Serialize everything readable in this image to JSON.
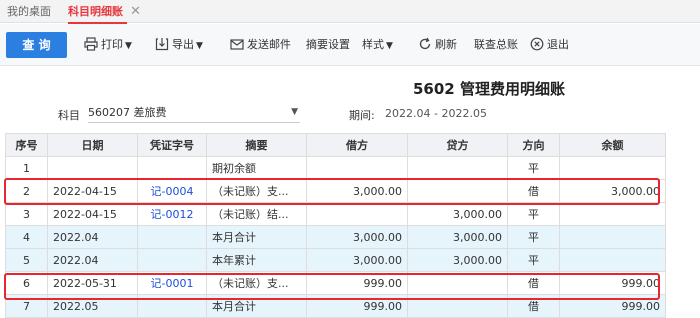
{
  "tabs": {
    "home": "我的桌面",
    "active": "科目明细账",
    "close": "✕"
  },
  "toolbar": {
    "query": "查 询",
    "print": "打印",
    "export": "导出",
    "send_email": "发送邮件",
    "summary_settings": "摘要设置",
    "style": "样式",
    "refresh": "刷新",
    "linked_ledger": "联查总账",
    "exit": "退出"
  },
  "report": {
    "title": "5602 管理费用明细账",
    "subject_label": "科目",
    "subject_value": "560207 差旅费",
    "period_label": "期间:",
    "period_value": "2022.04 - 2022.05"
  },
  "table": {
    "headers": [
      "序号",
      "日期",
      "凭证字号",
      "摘要",
      "借方",
      "贷方",
      "方向",
      "余额"
    ],
    "rows": [
      {
        "no": "1",
        "date": "",
        "voucher": "",
        "summary": "期初余额",
        "debit": "",
        "credit": "",
        "direction": "平",
        "balance": ""
      },
      {
        "no": "2",
        "date": "2022-04-15",
        "voucher": "记-0004",
        "summary": "（未记账）支...",
        "debit": "3,000.00",
        "credit": "",
        "direction": "借",
        "balance": "3,000.00"
      },
      {
        "no": "3",
        "date": "2022-04-15",
        "voucher": "记-0012",
        "summary": "（未记账）结...",
        "debit": "",
        "credit": "3,000.00",
        "direction": "平",
        "balance": ""
      },
      {
        "no": "4",
        "date": "2022.04",
        "voucher": "",
        "summary": "本月合计",
        "debit": "3,000.00",
        "credit": "3,000.00",
        "direction": "平",
        "balance": ""
      },
      {
        "no": "5",
        "date": "2022.04",
        "voucher": "",
        "summary": "本年累计",
        "debit": "3,000.00",
        "credit": "3,000.00",
        "direction": "平",
        "balance": ""
      },
      {
        "no": "6",
        "date": "2022-05-31",
        "voucher": "记-0001",
        "summary": "（未记账）支...",
        "debit": "999.00",
        "credit": "",
        "direction": "借",
        "balance": "999.00"
      },
      {
        "no": "7",
        "date": "2022.05",
        "voucher": "",
        "summary": "本月合计",
        "debit": "999.00",
        "credit": "",
        "direction": "借",
        "balance": "999.00"
      }
    ]
  },
  "colors": {
    "accent": "#e6373f",
    "primary": "#2b7fe0",
    "voucher_link": "#1e4fd8",
    "highlight_box": "#e8262e",
    "row_tint": "#e6f5fb"
  }
}
